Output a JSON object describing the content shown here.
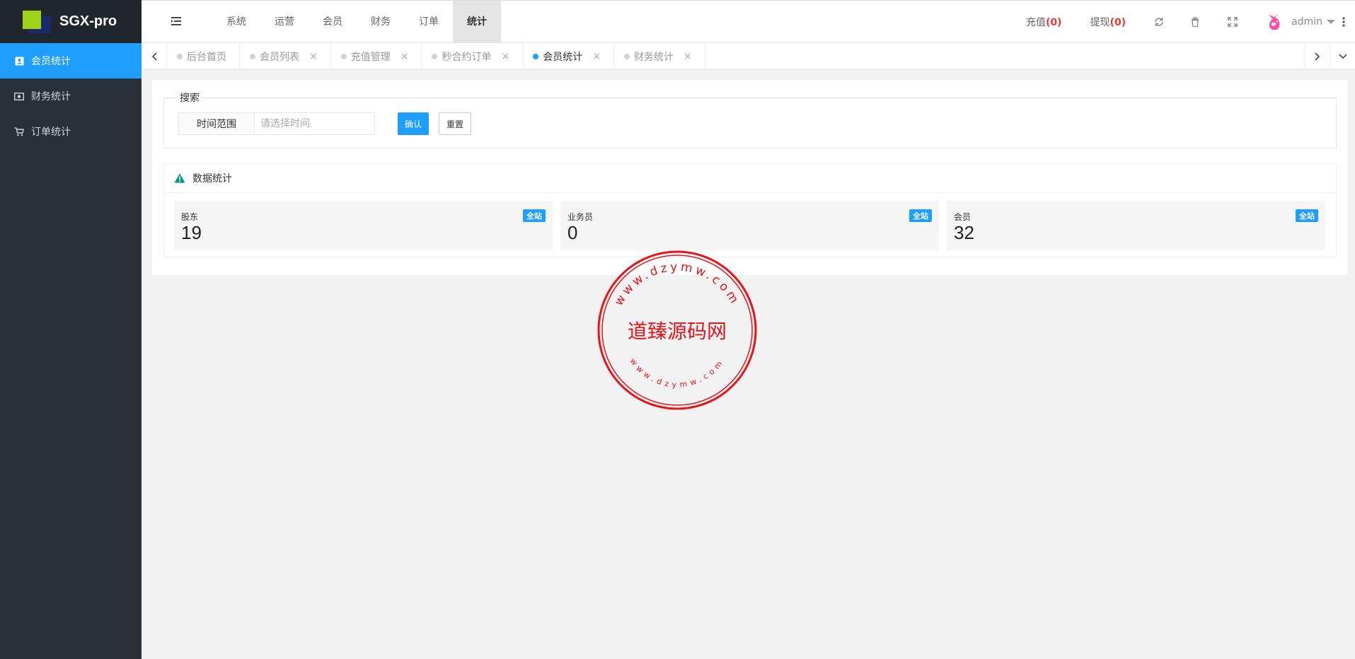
{
  "app": {
    "title": "SGX-pro"
  },
  "sidebar": {
    "items": [
      {
        "label": "会员统计",
        "icon": "member-card-icon",
        "active": true
      },
      {
        "label": "财务统计",
        "icon": "money-icon",
        "active": false
      },
      {
        "label": "订单统计",
        "icon": "cart-icon",
        "active": false
      }
    ]
  },
  "header": {
    "nav": [
      {
        "label": "系统",
        "active": false
      },
      {
        "label": "运营",
        "active": false
      },
      {
        "label": "会员",
        "active": false
      },
      {
        "label": "财务",
        "active": false
      },
      {
        "label": "订单",
        "active": false
      },
      {
        "label": "统计",
        "active": true
      }
    ],
    "recharge_label": "充值",
    "recharge_count": "(0)",
    "withdraw_label": "提现",
    "withdraw_count": "(0)",
    "user": "admin"
  },
  "tabs": [
    {
      "label": "后台首页",
      "closable": false,
      "active": false
    },
    {
      "label": "会员列表",
      "closable": true,
      "active": false
    },
    {
      "label": "充值管理",
      "closable": true,
      "active": false
    },
    {
      "label": "秒合约订单",
      "closable": true,
      "active": false
    },
    {
      "label": "会员统计",
      "closable": true,
      "active": true
    },
    {
      "label": "财务统计",
      "closable": true,
      "active": false
    }
  ],
  "search": {
    "legend": "搜索",
    "range_label": "时间范围",
    "placeholder": "请选择时间",
    "confirm": "确认",
    "reset": "重置"
  },
  "stats_panel": {
    "title": "数据统计",
    "items": [
      {
        "label": "股东",
        "value": "19",
        "badge": "全站"
      },
      {
        "label": "业务员",
        "value": "0",
        "badge": "全站"
      },
      {
        "label": "会员",
        "value": "32",
        "badge": "全站"
      }
    ]
  },
  "watermark": {
    "name": "道臻源码网",
    "url_top": "www.dzymw.com",
    "url_bottom": "www.dzymw.com",
    "color": "#e8131b"
  },
  "colors": {
    "accent": "#1e9fff",
    "sidebar": "#28303a",
    "alert": "#e53935"
  }
}
